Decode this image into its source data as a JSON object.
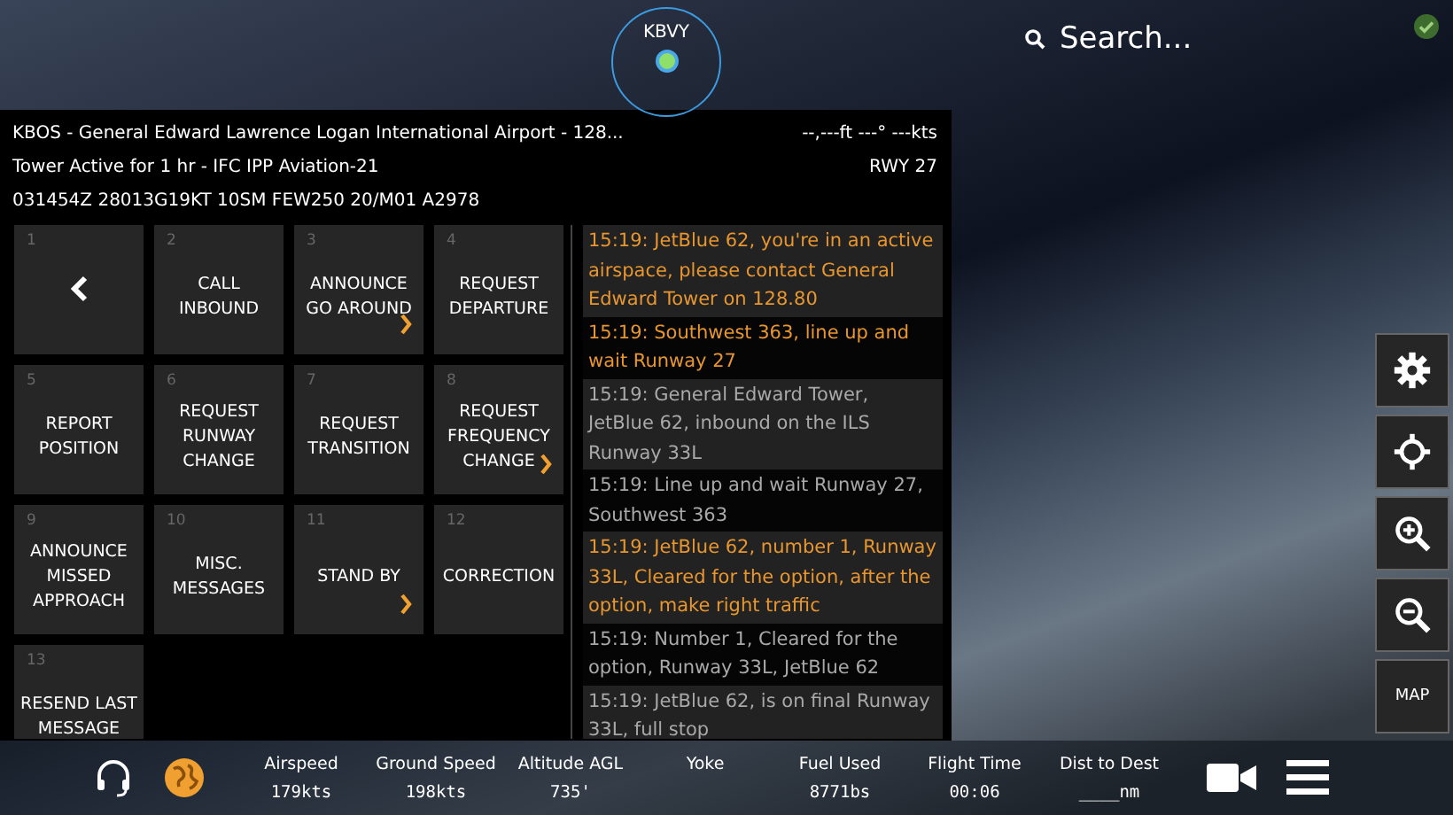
{
  "map": {
    "airport": "KBVY"
  },
  "search": {
    "placeholder": "Search..."
  },
  "header": {
    "facility": "KBOS - General Edward Lawrence Logan International Airport - 128...",
    "readout": "--,---ft  ---° ---kts",
    "status": "Tower Active for 1 hr - IFC IPP Aviation-21",
    "runway": "RWY 27",
    "metar": "031454Z 28013G19KT 10SM FEW250 20/M01 A2978"
  },
  "commands": [
    {
      "number": "1",
      "kind": "back",
      "submenu": false
    },
    {
      "number": "2",
      "kind": "command",
      "label": "CALL INBOUND",
      "submenu": false
    },
    {
      "number": "3",
      "kind": "command",
      "label": "ANNOUNCE GO AROUND",
      "submenu": true
    },
    {
      "number": "4",
      "kind": "command",
      "label": "REQUEST DEPARTURE",
      "submenu": false
    },
    {
      "number": "5",
      "kind": "command",
      "label": "REPORT POSITION",
      "submenu": false
    },
    {
      "number": "6",
      "kind": "command",
      "label": "REQUEST RUNWAY CHANGE",
      "submenu": false
    },
    {
      "number": "7",
      "kind": "command",
      "label": "REQUEST TRANSITION",
      "submenu": false
    },
    {
      "number": "8",
      "kind": "command",
      "label": "REQUEST FREQUENCY CHANGE",
      "submenu": true
    },
    {
      "number": "9",
      "kind": "command",
      "label": "ANNOUNCE MISSED APPROACH",
      "submenu": false
    },
    {
      "number": "10",
      "kind": "command",
      "label": "MISC. MESSAGES",
      "submenu": false
    },
    {
      "number": "11",
      "kind": "command",
      "label": "STAND BY",
      "submenu": true
    },
    {
      "number": "12",
      "kind": "command",
      "label": "CORRECTION",
      "submenu": false
    },
    {
      "number": "13",
      "kind": "command",
      "label": "RESEND LAST MESSAGE",
      "submenu": false
    }
  ],
  "messages": [
    {
      "text": "15:19: JetBlue 62, you're in an active airspace,  please contact General Edward Tower on 128.80",
      "highlighted": true
    },
    {
      "text": "15:19: Southwest 363, line up and wait Runway 27",
      "highlighted": true
    },
    {
      "text": "15:19: General Edward Tower, JetBlue 62, inbound on the ILS Runway 33L",
      "highlighted": false
    },
    {
      "text": "15:19: Line up and wait Runway 27, Southwest 363",
      "highlighted": false
    },
    {
      "text": "15:19: JetBlue 62, number 1, Runway 33L, Cleared for the option, after the option, make right traffic",
      "highlighted": true
    },
    {
      "text": "15:19: Number 1, Cleared for the option, Runway 33L, JetBlue 62",
      "highlighted": false
    },
    {
      "text": "15:19: JetBlue 62, is on final Runway 33L, full stop",
      "highlighted": false
    }
  ],
  "side_buttons": [
    {
      "kind": "settings"
    },
    {
      "kind": "center"
    },
    {
      "kind": "zoom-in"
    },
    {
      "kind": "zoom-out"
    },
    {
      "kind": "text",
      "label": "MAP"
    }
  ],
  "stats": [
    {
      "label": "Airspeed",
      "value": "179kts"
    },
    {
      "label": "Ground Speed",
      "value": "198kts"
    },
    {
      "label": "Altitude AGL",
      "value": "735'"
    },
    {
      "label": "Yoke"
    },
    {
      "label": "Fuel Used",
      "value": "8771bs"
    },
    {
      "label": "Flight Time",
      "value": "00:06"
    },
    {
      "label": "Dist to Dest",
      "value": "____nm"
    }
  ]
}
